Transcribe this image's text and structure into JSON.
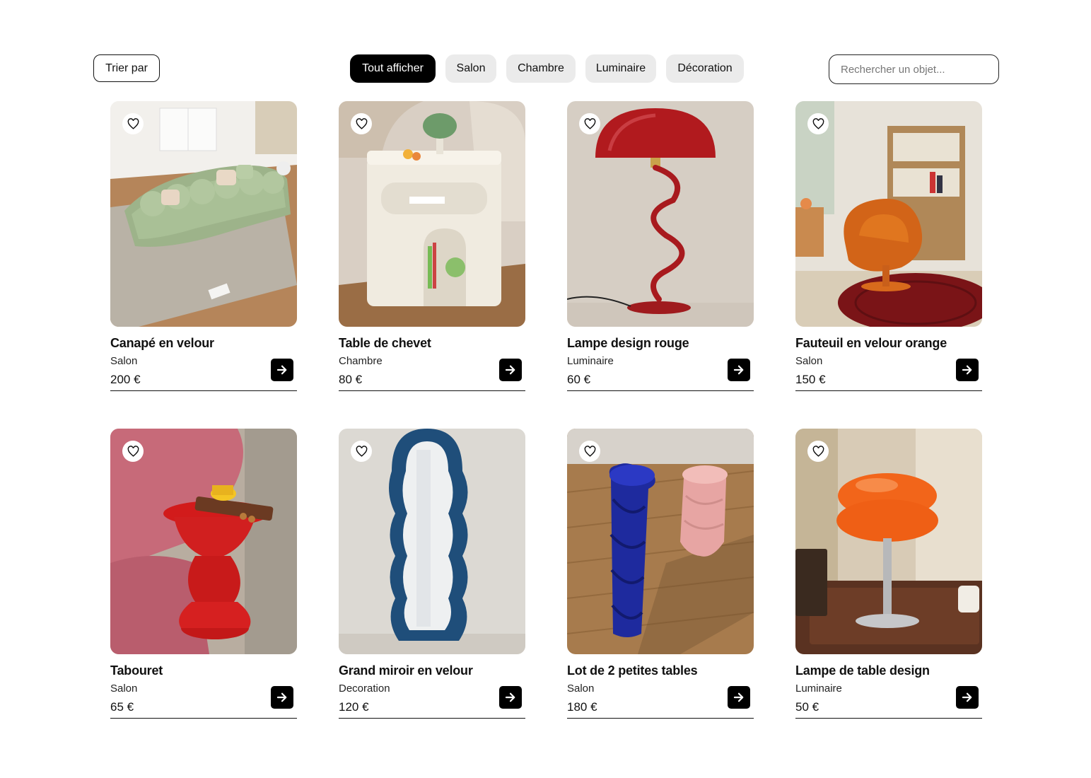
{
  "toolbar": {
    "sort_label": "Trier par",
    "filters": [
      {
        "label": "Tout afficher",
        "active": true
      },
      {
        "label": "Salon",
        "active": false
      },
      {
        "label": "Chambre",
        "active": false
      },
      {
        "label": "Luminaire",
        "active": false
      },
      {
        "label": "Décoration",
        "active": false
      }
    ],
    "search_placeholder": "Rechercher un objet..."
  },
  "products": [
    {
      "title": "Canapé en velour",
      "category": "Salon",
      "price": "200 €",
      "image": "green-sofa"
    },
    {
      "title": "Table de chevet",
      "category": "Chambre",
      "price": "80 €",
      "image": "cream-nightstand"
    },
    {
      "title": "Lampe design rouge",
      "category": "Luminaire",
      "price": "60 €",
      "image": "red-wave-lamp"
    },
    {
      "title": "Fauteuil en velour orange",
      "category": "Salon",
      "price": "150 €",
      "image": "orange-armchair"
    },
    {
      "title": "Tabouret",
      "category": "Salon",
      "price": "65 €",
      "image": "red-stool"
    },
    {
      "title": "Grand miroir en velour",
      "category": "Decoration",
      "price": "120 €",
      "image": "wavy-mirror"
    },
    {
      "title": "Lot de 2 petites tables",
      "category": "Salon",
      "price": "180 €",
      "image": "twisted-side-tables"
    },
    {
      "title": "Lampe de table design",
      "category": "Luminaire",
      "price": "50 €",
      "image": "orange-table-lamp"
    }
  ],
  "icons": {
    "favorite": "heart-icon",
    "open": "arrow-right-icon"
  }
}
